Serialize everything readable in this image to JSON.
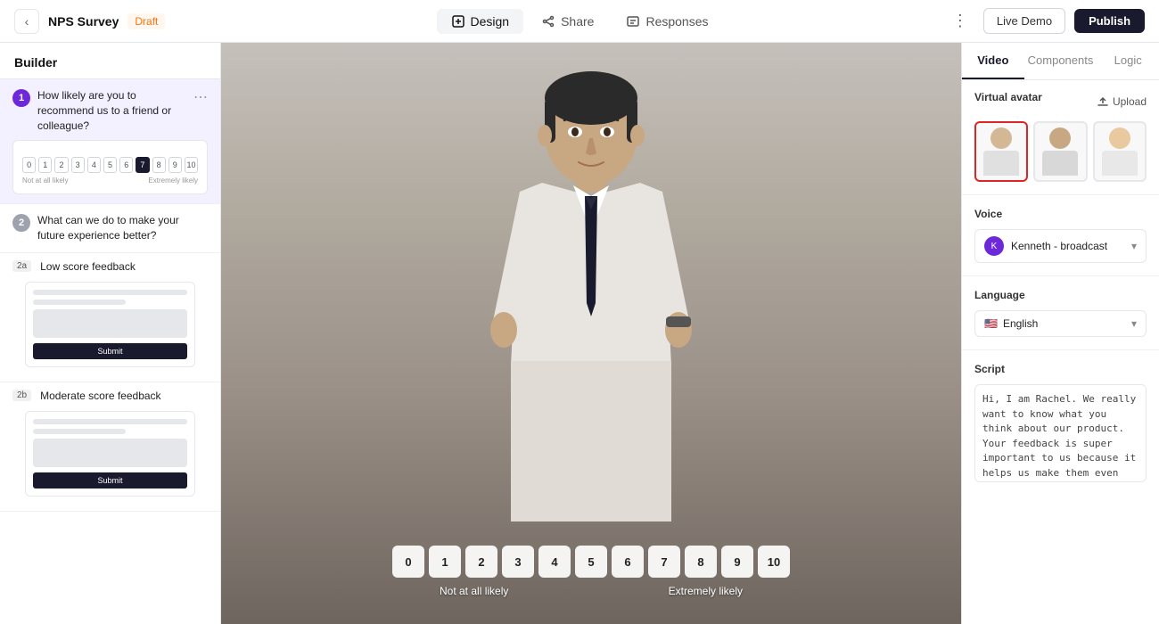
{
  "topNav": {
    "back_label": "‹",
    "title": "NPS Survey",
    "draft_label": "Draft",
    "tabs": [
      {
        "id": "design",
        "label": "Design",
        "icon": "design"
      },
      {
        "id": "share",
        "label": "Share",
        "icon": "share"
      },
      {
        "id": "responses",
        "label": "Responses",
        "icon": "responses"
      }
    ],
    "more_icon": "⋮",
    "live_demo_label": "Live Demo",
    "publish_label": "Publish"
  },
  "sidebar": {
    "header": "Builder",
    "questions": [
      {
        "num": "1",
        "text": "How likely are you to recommend us to a friend or colleague?",
        "type": "nps",
        "selected_value": "7"
      },
      {
        "num": "2",
        "text": "What can we do to make your future experience better?",
        "type": "text"
      },
      {
        "num": "2a",
        "sub": true,
        "sub_label": "Low score feedback",
        "type": "feedback"
      },
      {
        "num": "2b",
        "sub": true,
        "sub_label": "Moderate score feedback",
        "type": "feedback"
      }
    ]
  },
  "npsButtons": [
    "0",
    "1",
    "2",
    "3",
    "4",
    "5",
    "6",
    "7",
    "8",
    "9",
    "10"
  ],
  "npsLabels": {
    "left": "Not at all likely",
    "right": "Extremely likely"
  },
  "rightPanel": {
    "tabs": [
      "Video",
      "Components",
      "Logic"
    ],
    "active_tab": "Video",
    "sections": {
      "virtual_avatar": {
        "label": "Virtual avatar",
        "upload_label": "Upload",
        "avatars": [
          {
            "id": "male-formal",
            "selected": true
          },
          {
            "id": "female-dark",
            "selected": false
          },
          {
            "id": "female-light",
            "selected": false
          }
        ]
      },
      "voice": {
        "label": "Voice",
        "selected": "Kenneth - broadcast",
        "icon": "K"
      },
      "language": {
        "label": "Language",
        "selected": "English",
        "flag": "🇺🇸"
      },
      "script": {
        "label": "Script",
        "text": "Hi, I am Rachel. We really want to know what you think about our product. Your feedback is super important to us because it helps us make them even better for you. So would you mind telling us how likely you are to recommend us to a friend"
      }
    }
  }
}
